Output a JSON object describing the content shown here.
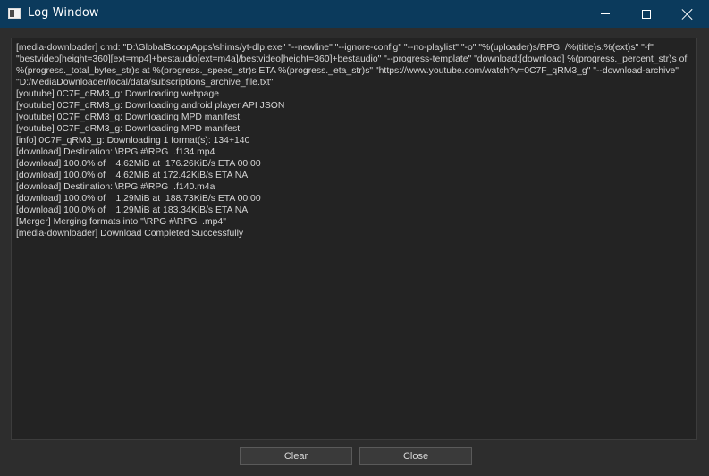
{
  "window": {
    "title": "Log Window",
    "icon": "app-window-icon",
    "controls": {
      "minimize": "minimize-icon",
      "maximize": "maximize-icon",
      "close": "close-icon"
    }
  },
  "log": {
    "lines": [
      "[media-downloader] cmd: \"D:\\GlobalScoopApps\\shims/yt-dlp.exe\" \"--newline\" \"--ignore-config\" \"--no-playlist\" \"-o\" \"%(uploader)s/RPG  /%(title)s.%(ext)s\" \"-f\" \"bestvideo[height=360][ext=mp4]+bestaudio[ext=m4a]/bestvideo[height=360]+bestaudio\" \"--progress-template\" \"download:[download] %(progress._percent_str)s of %(progress._total_bytes_str)s at %(progress._speed_str)s ETA %(progress._eta_str)s\" \"https://www.youtube.com/watch?v=0C7F_qRM3_g\" \"--download-archive\" \"D:/MediaDownloader/local/data/subscriptions_archive_file.txt\"",
      "[youtube] 0C7F_qRM3_g: Downloading webpage",
      "[youtube] 0C7F_qRM3_g: Downloading android player API JSON",
      "[youtube] 0C7F_qRM3_g: Downloading MPD manifest",
      "[youtube] 0C7F_qRM3_g: Downloading MPD manifest",
      "[info] 0C7F_qRM3_g: Downloading 1 format(s): 134+140",
      "[download] Destination: \\RPG #\\RPG  .f134.mp4",
      "[download] 100.0% of    4.62MiB at  176.26KiB/s ETA 00:00",
      "[download] 100.0% of    4.62MiB at 172.42KiB/s ETA NA",
      "[download] Destination: \\RPG #\\RPG  .f140.m4a",
      "[download] 100.0% of    1.29MiB at  188.73KiB/s ETA 00:00",
      "[download] 100.0% of    1.29MiB at 183.34KiB/s ETA NA",
      "[Merger] Merging formats into \"\\RPG #\\RPG  .mp4\"",
      "[media-downloader] Download Completed Successfully"
    ]
  },
  "buttons": {
    "clear": "Clear",
    "close": "Close"
  },
  "colors": {
    "titlebar": "#0b3a5c",
    "background": "#2d2d2d",
    "log_background": "#232323",
    "text": "#d6d6d6"
  }
}
